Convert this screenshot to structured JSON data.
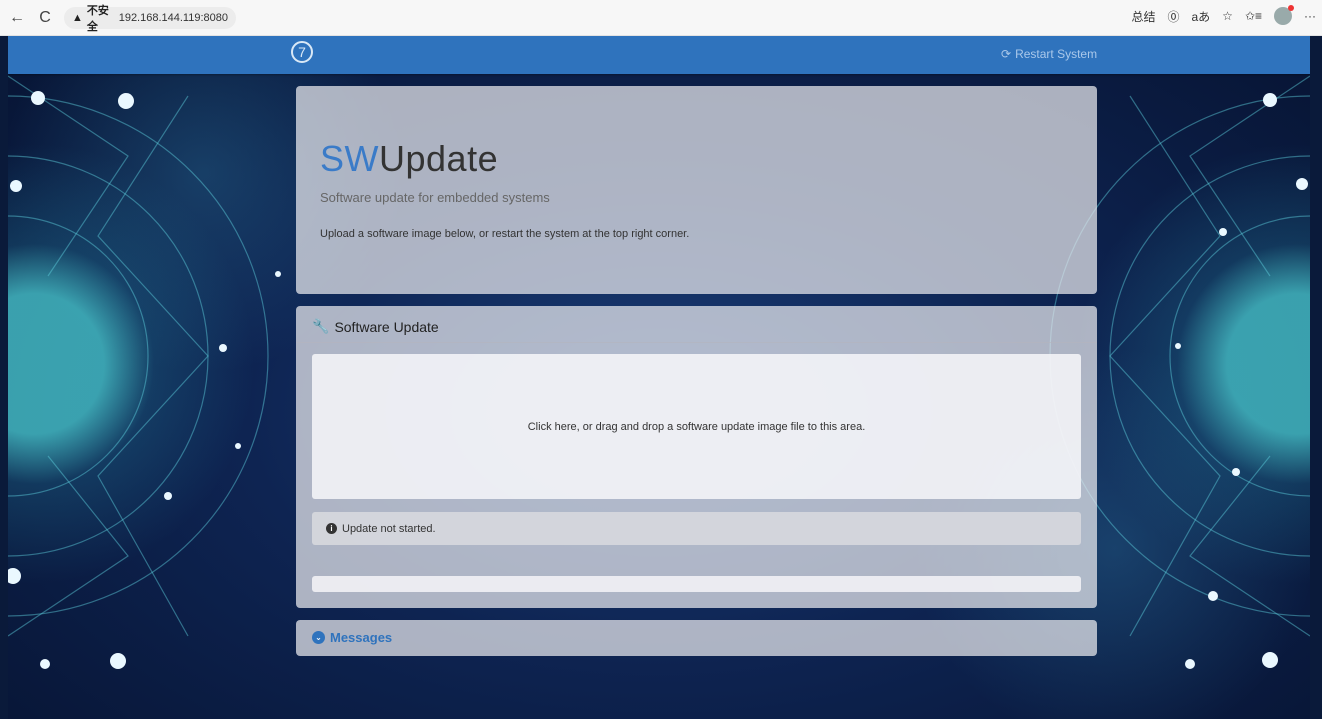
{
  "browser": {
    "back_icon": "←",
    "refresh_icon": "C",
    "warning_icon": "▲",
    "security_label": "不安全",
    "url": "192.168.144.119:8080",
    "right_items": [
      "总结",
      "⓪",
      "aあ",
      "☆",
      "✩≡",
      "···"
    ]
  },
  "nav": {
    "logo_glyph": "7",
    "restart_icon": "⟳",
    "restart_label": "Restart System"
  },
  "jumbotron": {
    "title_accent": "SW",
    "title_rest": "Update",
    "subtitle": "Software update for embedded systems",
    "lead": "Upload a software image below, or restart the system at the top right corner."
  },
  "update": {
    "header_icon": "🔧",
    "header": "Software Update",
    "dropzone_text": "Click here, or drag and drop a software update image file to this area.",
    "status_icon": "i",
    "status_text": "Update not started.",
    "progress": 0
  },
  "messages": {
    "icon": "⌄",
    "header": "Messages"
  },
  "colors": {
    "navbar": "#2f73bd",
    "accent": "#3a7bc8"
  }
}
